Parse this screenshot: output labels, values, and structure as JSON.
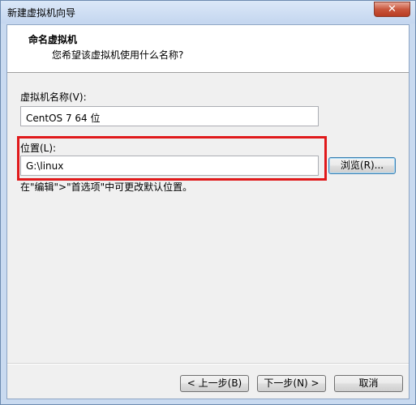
{
  "window": {
    "title": "新建虚拟机向导",
    "close_label": "✕"
  },
  "header": {
    "title": "命名虚拟机",
    "subtitle": "您希望该虚拟机使用什么名称?"
  },
  "vm_name": {
    "label": "虚拟机名称(V):",
    "value": "CentOS 7 64 位"
  },
  "location": {
    "label": "位置(L):",
    "value": "G:\\linux",
    "browse_label": "浏览(R)..."
  },
  "hint": "在\"编辑\">\"首选项\"中可更改默认位置。",
  "footer": {
    "back_label": "< 上一步(B)",
    "next_label": "下一步(N) >",
    "cancel_label": "取消"
  },
  "colors": {
    "highlight_border": "#e0191b",
    "title_bar": "#c9daf0"
  }
}
